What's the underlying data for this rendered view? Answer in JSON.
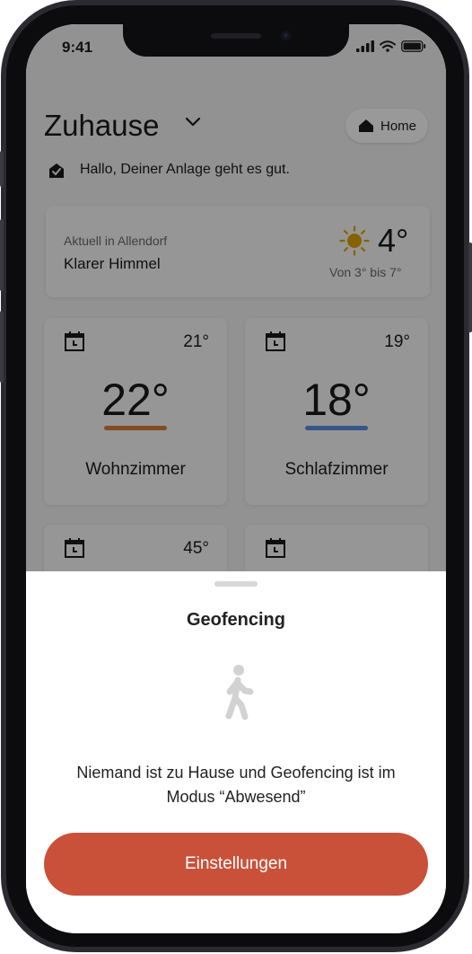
{
  "status_bar": {
    "time": "9:41"
  },
  "header": {
    "title": "Zuhause",
    "home_button_label": "Home"
  },
  "system_status": {
    "text": "Hallo, Deiner Anlage geht es gut."
  },
  "weather": {
    "location": "Aktuell in Allendorf",
    "condition": "Klarer Himmel",
    "temperature": "4°",
    "range": "Von 3° bis 7°",
    "icon": "sun-icon"
  },
  "rooms": [
    {
      "name": "Wohnzimmer",
      "setpoint": "21°",
      "current": "22°",
      "bar_color": "#d9813a"
    },
    {
      "name": "Schlafzimmer",
      "setpoint": "19°",
      "current": "18°",
      "bar_color": "#5b8fe0"
    },
    {
      "name": "",
      "setpoint": "45°",
      "current": ""
    },
    {
      "name": "",
      "setpoint": "",
      "current": ""
    }
  ],
  "sheet": {
    "title": "Geofencing",
    "message": "Niemand ist zu Hause und Geofencing ist im Modus “Abwesend”",
    "button_label": "Einstellungen",
    "icon": "walking-person-icon"
  },
  "colors": {
    "accent": "#c9513a",
    "warm_bar": "#d9813a",
    "cool_bar": "#5b8fe0",
    "sun": "#e0a400"
  }
}
